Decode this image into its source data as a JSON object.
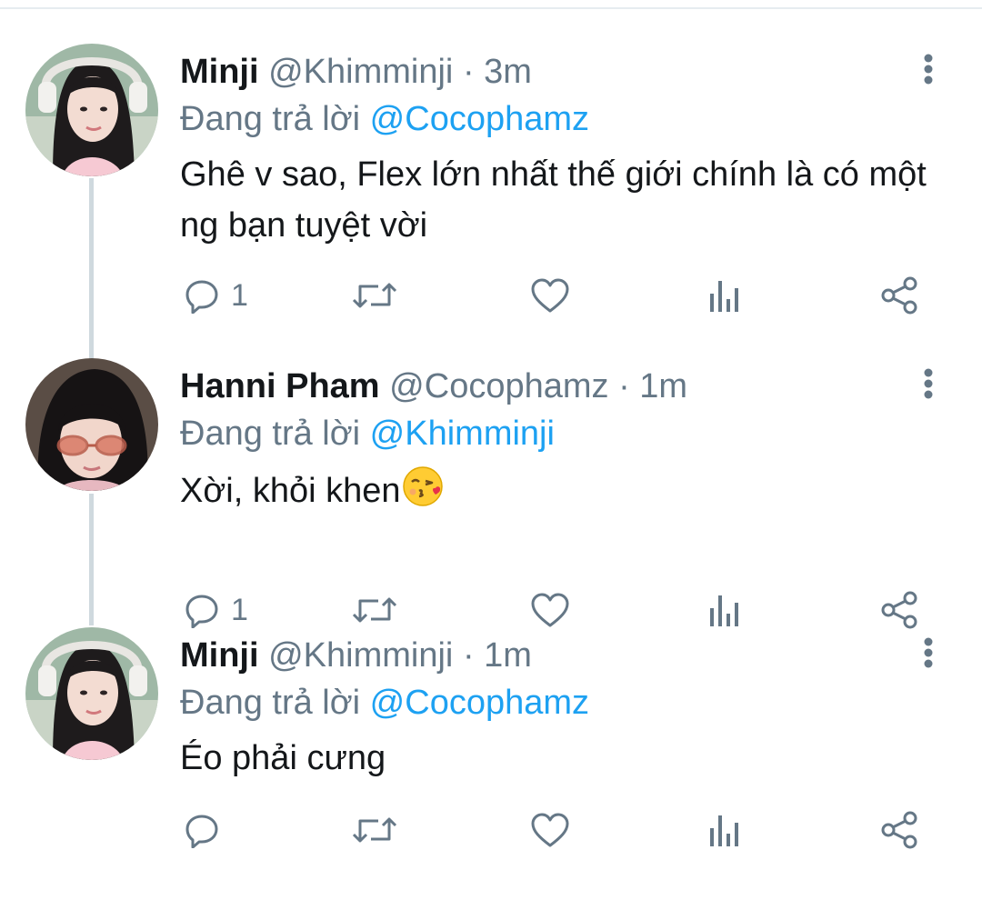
{
  "thread": {
    "tweets": [
      {
        "display_name": "Minji",
        "handle": "@Khimminji",
        "separator": "·",
        "time": "3m",
        "reply_prefix": "Đang trả lời",
        "reply_to": "@Cocophamz",
        "text": "Ghê v sao, Flex lớn nhất thế giới chính là có một ng bạn tuyệt vời",
        "reply_count": "1",
        "avatar_icon": "girl-with-headphones-avatar"
      },
      {
        "display_name": "Hanni Pham",
        "handle": "@Cocophamz",
        "separator": "·",
        "time": "1m",
        "reply_prefix": "Đang trả lời",
        "reply_to": "@Khimminji",
        "text": "Xời, khỏi khen",
        "emoji": "face-blowing-a-kiss-emoji",
        "reply_count": "1",
        "avatar_icon": "girl-with-sunglasses-avatar"
      },
      {
        "display_name": "Minji",
        "handle": "@Khimminji",
        "separator": "·",
        "time": "1m",
        "reply_prefix": "Đang trả lời",
        "reply_to": "@Cocophamz",
        "text": "Éo phải cưng",
        "reply_count": "",
        "avatar_icon": "girl-with-headphones-avatar"
      }
    ]
  },
  "colors": {
    "text": "#14171a",
    "secondary": "#657786",
    "link": "#1da1f2",
    "thread_line": "#cfd9de",
    "icon": "#657786"
  }
}
